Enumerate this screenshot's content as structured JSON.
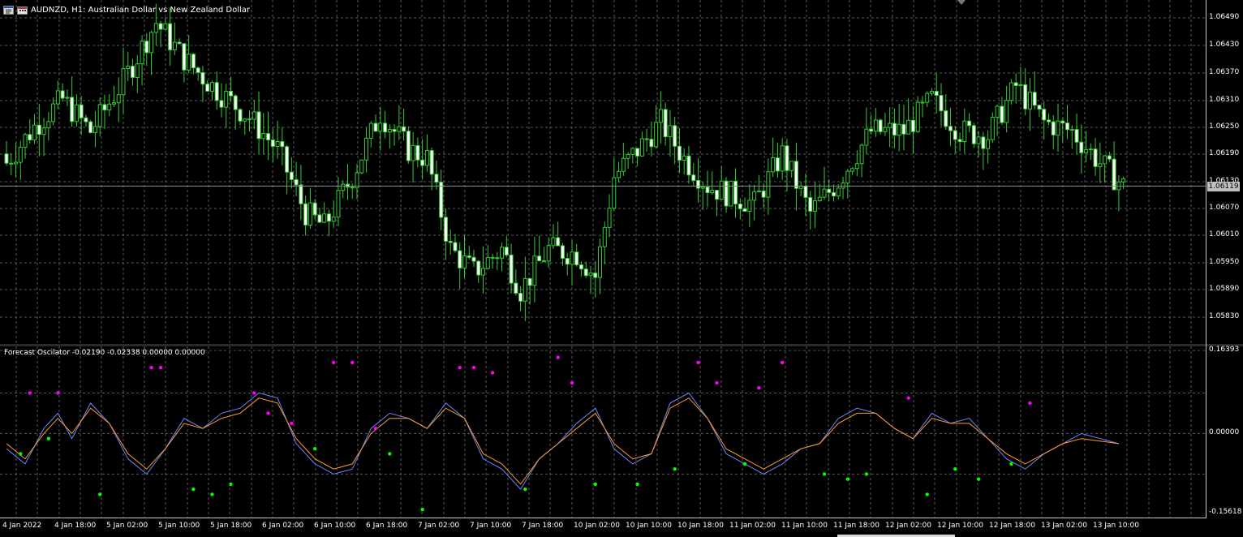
{
  "header": {
    "title": "AUDNZD, H1:  Australian Dollar vs New Zealand Dollar",
    "icons": [
      "chart-window-icon",
      "calendar-icon"
    ]
  },
  "indicator": {
    "title": "Forecast Oscilator -0.02190 -0.02338 0.00000 0.00000"
  },
  "price_axis": {
    "labels": [
      "1.06490",
      "1.06430",
      "1.06370",
      "1.06310",
      "1.06250",
      "1.06190",
      "1.06130",
      "1.06070",
      "1.06010",
      "1.05950",
      "1.05890",
      "1.05830"
    ],
    "current_price": "1.06119"
  },
  "osc_axis": {
    "labels": [
      "0.16393",
      "0.00000",
      "-0.15618"
    ]
  },
  "time_axis": {
    "labels": [
      "4 Jan 2022",
      "4 Jan 18:00",
      "5 Jan 02:00",
      "5 Jan 10:00",
      "5 Jan 18:00",
      "6 Jan 02:00",
      "6 Jan 10:00",
      "6 Jan 18:00",
      "7 Jan 02:00",
      "7 Jan 10:00",
      "7 Jan 18:00",
      "10 Jan 02:00",
      "10 Jan 10:00",
      "10 Jan 18:00",
      "11 Jan 02:00",
      "11 Jan 10:00",
      "11 Jan 18:00",
      "12 Jan 02:00",
      "12 Jan 10:00",
      "12 Jan 18:00",
      "13 Jan 02:00",
      "13 Jan 10:00"
    ]
  },
  "colors": {
    "background": "#000000",
    "grid": "#5a5a5a",
    "candle_bull": "#000000",
    "candle_bear": "#ffffff",
    "candle_wick": "#33cc33",
    "bid_line": "#8f8f8f",
    "forecast_line": "#6f86ff",
    "signal_line": "#ff9d2e",
    "dot_high": "#ff00ff",
    "dot_low": "#00ff00"
  },
  "chart_data": [
    {
      "type": "candlestick",
      "title": "AUDNZD, H1:  Australian Dollar vs New Zealand Dollar",
      "ylim": [
        1.0579,
        1.0653
      ],
      "x_range_bars": [
        0,
        240
      ],
      "grid": true,
      "bid_price": 1.06119,
      "anchors_close": [
        [
          0,
          1.0617
        ],
        [
          6,
          1.0625
        ],
        [
          12,
          1.0631
        ],
        [
          18,
          1.0624
        ],
        [
          25,
          1.0635
        ],
        [
          32,
          1.0648
        ],
        [
          38,
          1.064
        ],
        [
          44,
          1.0634
        ],
        [
          52,
          1.0627
        ],
        [
          58,
          1.062
        ],
        [
          64,
          1.0606
        ],
        [
          68,
          1.0603
        ],
        [
          74,
          1.0614
        ],
        [
          80,
          1.0628
        ],
        [
          86,
          1.062
        ],
        [
          90,
          1.0618
        ],
        [
          95,
          1.0598
        ],
        [
          100,
          1.0593
        ],
        [
          106,
          1.0598
        ],
        [
          110,
          1.0589
        ],
        [
          116,
          1.0598
        ],
        [
          122,
          1.0597
        ],
        [
          126,
          1.0592
        ],
        [
          130,
          1.0614
        ],
        [
          136,
          1.0621
        ],
        [
          140,
          1.0626
        ],
        [
          145,
          1.0618
        ],
        [
          150,
          1.0612
        ],
        [
          155,
          1.061
        ],
        [
          160,
          1.0608
        ],
        [
          166,
          1.0619
        ],
        [
          172,
          1.0606
        ],
        [
          178,
          1.0613
        ],
        [
          185,
          1.0624
        ],
        [
          192,
          1.0624
        ],
        [
          198,
          1.0631
        ],
        [
          204,
          1.0624
        ],
        [
          210,
          1.0623
        ],
        [
          216,
          1.0634
        ],
        [
          222,
          1.0626
        ],
        [
          228,
          1.0624
        ],
        [
          234,
          1.0617
        ],
        [
          239,
          1.0612
        ]
      ]
    },
    {
      "type": "line",
      "title": "Forecast Oscilator -0.02190 -0.02338 0.00000 0.00000",
      "ylim": [
        -0.15618,
        0.16393
      ],
      "x_range_bars": [
        0,
        240
      ],
      "series": [
        {
          "values": [
            [
              0,
              -0.03
            ],
            [
              4,
              -0.06
            ],
            [
              8,
              0.01
            ],
            [
              11,
              0.04
            ],
            [
              14,
              -0.01
            ],
            [
              18,
              0.06
            ],
            [
              22,
              0.02
            ],
            [
              26,
              -0.05
            ],
            [
              30,
              -0.08
            ],
            [
              34,
              -0.03
            ],
            [
              38,
              0.03
            ],
            [
              42,
              0.01
            ],
            [
              46,
              0.04
            ],
            [
              50,
              0.05
            ],
            [
              54,
              0.08
            ],
            [
              58,
              0.07
            ],
            [
              62,
              -0.02
            ],
            [
              66,
              -0.06
            ],
            [
              70,
              -0.08
            ],
            [
              74,
              -0.07
            ],
            [
              78,
              0.01
            ],
            [
              82,
              0.04
            ],
            [
              86,
              0.03
            ],
            [
              90,
              0.01
            ],
            [
              94,
              0.06
            ],
            [
              98,
              0.03
            ],
            [
              102,
              -0.05
            ],
            [
              106,
              -0.07
            ],
            [
              110,
              -0.11
            ],
            [
              114,
              -0.05
            ],
            [
              118,
              -0.02
            ],
            [
              122,
              0.02
            ],
            [
              126,
              0.05
            ],
            [
              130,
              -0.03
            ],
            [
              134,
              -0.06
            ],
            [
              138,
              -0.04
            ],
            [
              142,
              0.06
            ],
            [
              146,
              0.08
            ],
            [
              150,
              0.03
            ],
            [
              154,
              -0.04
            ],
            [
              158,
              -0.06
            ],
            [
              162,
              -0.08
            ],
            [
              166,
              -0.06
            ],
            [
              170,
              -0.03
            ],
            [
              174,
              -0.02
            ],
            [
              178,
              0.03
            ],
            [
              182,
              0.05
            ],
            [
              186,
              0.04
            ],
            [
              190,
              0.01
            ],
            [
              194,
              -0.01
            ],
            [
              198,
              0.04
            ],
            [
              202,
              0.02
            ],
            [
              206,
              0.03
            ],
            [
              210,
              -0.01
            ],
            [
              214,
              -0.05
            ],
            [
              218,
              -0.07
            ],
            [
              222,
              -0.04
            ],
            [
              226,
              -0.02
            ],
            [
              230,
              0.0
            ],
            [
              234,
              -0.01
            ],
            [
              238,
              -0.02
            ]
          ]
        },
        {
          "values": [
            [
              0,
              -0.02
            ],
            [
              4,
              -0.05
            ],
            [
              8,
              0.0
            ],
            [
              11,
              0.03
            ],
            [
              14,
              0.0
            ],
            [
              18,
              0.05
            ],
            [
              22,
              0.02
            ],
            [
              26,
              -0.04
            ],
            [
              30,
              -0.07
            ],
            [
              34,
              -0.03
            ],
            [
              38,
              0.02
            ],
            [
              42,
              0.01
            ],
            [
              46,
              0.03
            ],
            [
              50,
              0.04
            ],
            [
              54,
              0.07
            ],
            [
              58,
              0.06
            ],
            [
              62,
              -0.01
            ],
            [
              66,
              -0.05
            ],
            [
              70,
              -0.07
            ],
            [
              74,
              -0.06
            ],
            [
              78,
              0.0
            ],
            [
              82,
              0.03
            ],
            [
              86,
              0.03
            ],
            [
              90,
              0.01
            ],
            [
              94,
              0.05
            ],
            [
              98,
              0.03
            ],
            [
              102,
              -0.04
            ],
            [
              106,
              -0.06
            ],
            [
              110,
              -0.1
            ],
            [
              114,
              -0.05
            ],
            [
              118,
              -0.02
            ],
            [
              122,
              0.01
            ],
            [
              126,
              0.04
            ],
            [
              130,
              -0.02
            ],
            [
              134,
              -0.05
            ],
            [
              138,
              -0.04
            ],
            [
              142,
              0.05
            ],
            [
              146,
              0.07
            ],
            [
              150,
              0.03
            ],
            [
              154,
              -0.03
            ],
            [
              158,
              -0.05
            ],
            [
              162,
              -0.07
            ],
            [
              166,
              -0.05
            ],
            [
              170,
              -0.03
            ],
            [
              174,
              -0.02
            ],
            [
              178,
              0.02
            ],
            [
              182,
              0.04
            ],
            [
              186,
              0.04
            ],
            [
              190,
              0.01
            ],
            [
              194,
              -0.01
            ],
            [
              198,
              0.03
            ],
            [
              202,
              0.02
            ],
            [
              206,
              0.02
            ],
            [
              210,
              -0.01
            ],
            [
              214,
              -0.04
            ],
            [
              218,
              -0.06
            ],
            [
              222,
              -0.04
            ],
            [
              226,
              -0.02
            ],
            [
              230,
              -0.01
            ],
            [
              234,
              -0.015
            ],
            [
              238,
              -0.02
            ]
          ]
        }
      ],
      "dots_high": [
        [
          5,
          0.08
        ],
        [
          11,
          0.08
        ],
        [
          31,
          0.13
        ],
        [
          33,
          0.13
        ],
        [
          53,
          0.08
        ],
        [
          56,
          0.04
        ],
        [
          61,
          0.02
        ],
        [
          70,
          0.14
        ],
        [
          74,
          0.14
        ],
        [
          79,
          0.01
        ],
        [
          97,
          0.13
        ],
        [
          100,
          0.13
        ],
        [
          104,
          0.12
        ],
        [
          118,
          0.15
        ],
        [
          121,
          0.1
        ],
        [
          148,
          0.14
        ],
        [
          152,
          0.1
        ],
        [
          161,
          0.09
        ],
        [
          166,
          0.14
        ],
        [
          193,
          0.07
        ],
        [
          219,
          0.06
        ]
      ],
      "dots_low": [
        [
          3,
          -0.04
        ],
        [
          9,
          -0.01
        ],
        [
          20,
          -0.12
        ],
        [
          40,
          -0.11
        ],
        [
          44,
          -0.12
        ],
        [
          48,
          -0.1
        ],
        [
          66,
          -0.03
        ],
        [
          82,
          -0.04
        ],
        [
          89,
          -0.15
        ],
        [
          111,
          -0.11
        ],
        [
          126,
          -0.1
        ],
        [
          135,
          -0.1
        ],
        [
          143,
          -0.07
        ],
        [
          158,
          -0.06
        ],
        [
          175,
          -0.08
        ],
        [
          180,
          -0.09
        ],
        [
          184,
          -0.08
        ],
        [
          197,
          -0.12
        ],
        [
          203,
          -0.07
        ],
        [
          208,
          -0.09
        ],
        [
          215,
          -0.06
        ]
      ]
    }
  ]
}
